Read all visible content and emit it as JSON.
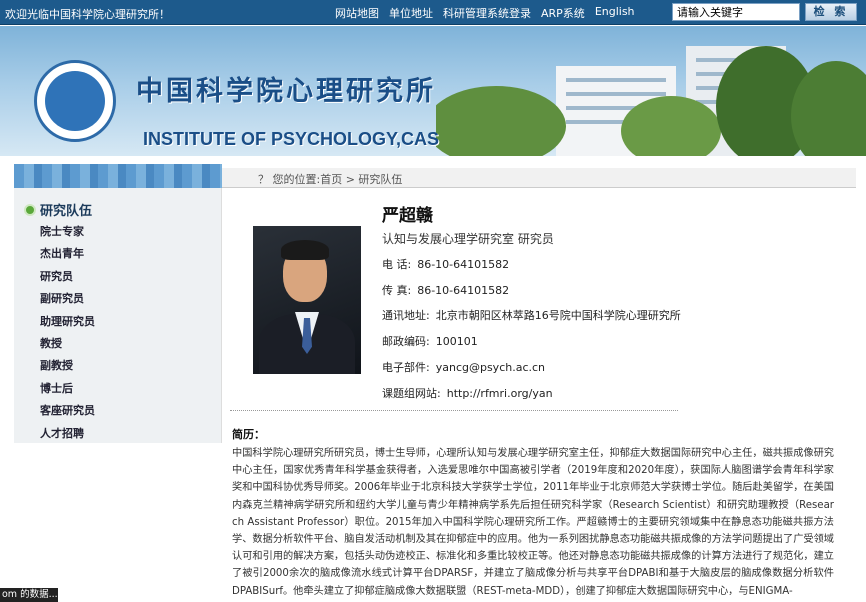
{
  "topbar": {
    "welcome": "欢迎光临中国科学院心理研究所！",
    "links": [
      "网站地图",
      "单位地址",
      "科研管理系统登录",
      "ARP系统",
      "English"
    ],
    "search_value": "请输入关键字",
    "search_button": "检 索"
  },
  "banner": {
    "title_cn": "中国科学院心理研究所",
    "title_en": "INSTITUTE OF PSYCHOLOGY,CAS"
  },
  "breadcrumb": "？ 您的位置:首页 > 研究队伍",
  "sidebar": {
    "title": "研究队伍",
    "items": [
      "院士专家",
      "杰出青年",
      "研究员",
      "副研究员",
      "助理研究员",
      "教授",
      "副教授",
      "博士后",
      "客座研究员",
      "人才招聘"
    ]
  },
  "profile": {
    "name": "严超赣",
    "dept": "认知与发展心理学研究室 研究员",
    "fields": [
      {
        "label": "电 话:",
        "value": "86-10-64101582"
      },
      {
        "label": "传 真:",
        "value": "86-10-64101582"
      },
      {
        "label": "通讯地址:",
        "value": "北京市朝阳区林萃路16号院中国科学院心理研究所"
      },
      {
        "label": "邮政编码:",
        "value": "100101"
      },
      {
        "label": "电子部件:",
        "value": "yancg@psych.ac.cn"
      },
      {
        "label": "课题组网站:",
        "value": "http://rfmri.org/yan"
      }
    ]
  },
  "bio": {
    "heading": "简历：",
    "text": "中国科学院心理研究所研究员，博士生导师，心理所认知与发展心理学研究室主任，抑郁症大数据国际研究中心主任，磁共振成像研究中心主任，国家优秀青年科学基金获得者，入选爱思唯尔中国高被引学者（2019年度和2020年度），获国际人脑图谱学会青年科学家奖和中国科协优秀导师奖。2006年毕业于北京科技大学获学士学位，2011年毕业于北京师范大学获博士学位。随后赴美留学，在美国内森克兰精神病学研究所和纽约大学儿童与青少年精神病学系先后担任研究科学家（Research Scientist）和研究助理教授（Research Assistant Professor）职位。2015年加入中国科学院心理研究所工作。严超赣博士的主要研究领域集中在静息态功能磁共振方法学、数据分析软件平台、脑自发活动机制及其在抑郁症中的应用。他为一系列困扰静息态功能磁共振成像的方法学问题提出了广受领域认可和引用的解决方案，包括头动伪迹校正、标准化和多重比较校正等。他还对静息态功能磁共振成像的计算方法进行了规范化，建立了被引2000余次的脑成像流水线式计算平台DPARSF，并建立了脑成像分析与共享平台DPABI和基于大脑皮层的脑成像数据分析软件DPABISurf。他牵头建立了抑郁症脑成像大数据联盟（REST-meta-MDD），创建了抑郁症大数据国际研究中心，与ENIGMA-"
  },
  "status_tooltip": "om 的数据..."
}
